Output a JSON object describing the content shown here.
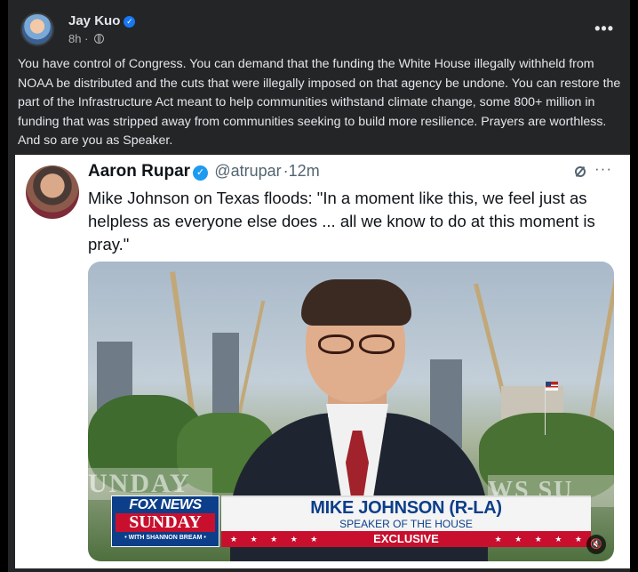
{
  "post": {
    "author": "Jay Kuo",
    "time": "8h",
    "separator": "·",
    "more": "•••",
    "text": "You have control of Congress. You can demand that the funding the White House illegally withheld from NOAA be distributed and the cuts that were illegally imposed on that agency be undone. You can restore the part of the Infrastructure Act meant to help communities withstand climate change, some 800+ million in funding that was stripped away from communities seeking to build more resilience. Prayers are worthless. And so are you as Speaker."
  },
  "tweet": {
    "name": "Aaron Rupar",
    "handle": "@atrupar",
    "time": "·12m",
    "more": "···",
    "text": "Mike Johnson on Texas floods: \"In a moment like this, we feel just as helpless as everyone else does ... all we know to do at this moment is pray.\""
  },
  "video": {
    "network": "FOX NEWS",
    "show": "SUNDAY",
    "host": "• WITH SHANNON BREAM •",
    "wall_text_left": "UNDAY",
    "wall_text_right": "WS SU",
    "lower_third_name": "MIKE JOHNSON (R-LA)",
    "lower_third_title": "SPEAKER OF THE HOUSE",
    "lower_third_tag": "EXCLUSIVE",
    "stars": "★ ★ ★ ★ ★",
    "mute_icon": "speaker-muted"
  },
  "colors": {
    "fb_background": "#242526",
    "verified_fb": "#1877f2",
    "verified_twitter": "#1d9bf0",
    "fox_red": "#c8102e",
    "fox_blue": "#0c3e8a"
  }
}
